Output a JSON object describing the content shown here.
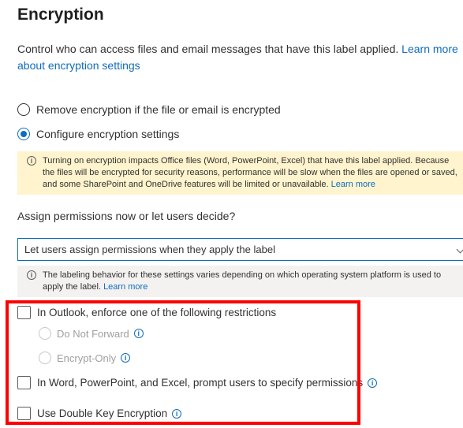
{
  "header": {
    "title": "Encryption"
  },
  "intro": {
    "text_line1": "Control who can access files and email messages that have this label applied.",
    "link_part1": "Learn more",
    "link_part2": "about encryption settings"
  },
  "encryption_options": [
    {
      "label": "Remove encryption if the file or email is encrypted",
      "selected": false
    },
    {
      "label": "Configure encryption settings",
      "selected": true
    }
  ],
  "warning_banner": {
    "icon": "info-icon",
    "text": "Turning on encryption impacts Office files (Word, PowerPoint, Excel) that have this label applied. Because the files will be encrypted for security reasons, performance will be slow when the files are opened or saved, and some SharePoint and OneDrive features will be limited or unavailable.",
    "link": "Learn more",
    "color": "#fff4ce"
  },
  "permissions": {
    "question": "Assign permissions now or let users decide?",
    "selected_value": "Let users assign permissions when they apply the label"
  },
  "info_banner": {
    "icon": "info-icon",
    "text": "The labeling behavior for these settings varies depending on which operating system platform is used to apply the label.",
    "link": "Learn more"
  },
  "restrictions": {
    "outlook_checkbox": {
      "label": "In Outlook, enforce one of the following restrictions",
      "checked": false
    },
    "outlook_options": [
      {
        "label": "Do Not Forward",
        "enabled": false
      },
      {
        "label": "Encrypt-Only",
        "enabled": false
      }
    ],
    "office_checkbox": {
      "label": "In Word, PowerPoint, and Excel, prompt users to specify permissions",
      "checked": false
    },
    "dke_checkbox": {
      "label": "Use Double Key Encryption",
      "checked": false
    }
  },
  "colors": {
    "accent": "#0f6cbd",
    "highlight": "#ff0000"
  }
}
